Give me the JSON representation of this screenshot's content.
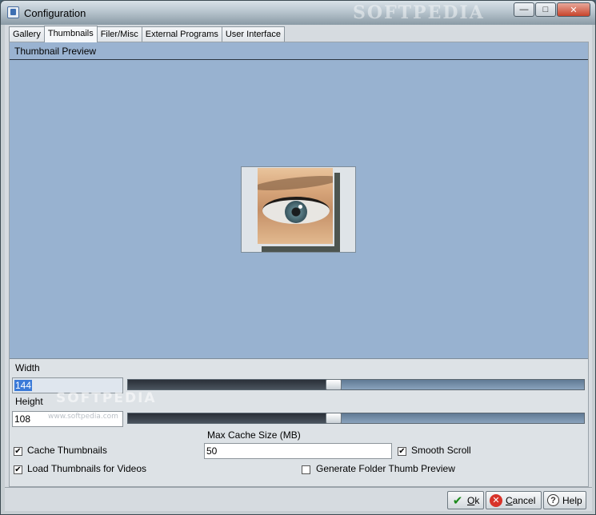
{
  "window": {
    "title": "Configuration",
    "watermark": "SOFTPEDIA",
    "controls": {
      "minimize": "—",
      "maximize": "□",
      "close": "✕"
    }
  },
  "tabs": [
    {
      "label": "Gallery",
      "active": false
    },
    {
      "label": "Thumbnails",
      "active": true
    },
    {
      "label": "Filer/Misc",
      "active": false
    },
    {
      "label": "External Programs",
      "active": false
    },
    {
      "label": "User Interface",
      "active": false
    }
  ],
  "preview": {
    "header": "Thumbnail Preview"
  },
  "width": {
    "label": "Width",
    "value": "144",
    "slider_fraction": 0.45
  },
  "height": {
    "label": "Height",
    "value": "108",
    "slider_fraction": 0.45
  },
  "watermarks": {
    "big": "SOFTPEDIA",
    "small": "www.softpedia.com"
  },
  "cache": {
    "label": "Max Cache Size (MB)",
    "value": "50"
  },
  "options": {
    "cache_thumbnails": {
      "label": "Cache Thumbnails",
      "checked": true
    },
    "load_videos": {
      "label": "Load Thumbnails for Videos",
      "checked": true
    },
    "smooth_scroll": {
      "label": "Smooth Scroll",
      "checked": true
    },
    "folder_preview": {
      "label": "Generate Folder Thumb Preview",
      "checked": false
    }
  },
  "buttons": {
    "ok": {
      "accel": "O",
      "rest": "k"
    },
    "cancel": {
      "accel": "C",
      "rest": "ancel"
    },
    "help": "Help"
  },
  "icons": {
    "app": "app-icon",
    "ok": "checkmark-icon",
    "cancel": "cancel-icon",
    "help": "question-icon"
  }
}
